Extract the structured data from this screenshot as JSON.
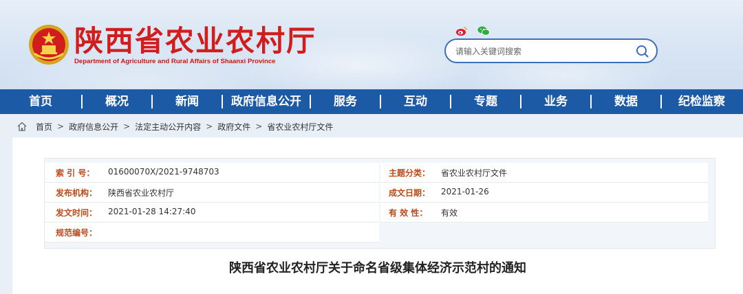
{
  "header": {
    "title": "陕西省农业农村厅",
    "subtitle": "Department of Agriculture and Rural Affairs of Shaanxi Province",
    "social": [
      "weibo-icon",
      "wechat-icon"
    ],
    "search": {
      "placeholder": "请输入关键词搜索"
    }
  },
  "nav": {
    "items": [
      {
        "label": "首页"
      },
      {
        "label": "概况"
      },
      {
        "label": "新闻"
      },
      {
        "label": "政府信息公开"
      },
      {
        "label": "服务"
      },
      {
        "label": "互动"
      },
      {
        "label": "专题"
      },
      {
        "label": "业务"
      },
      {
        "label": "数据"
      },
      {
        "label": "纪检监察"
      }
    ]
  },
  "breadcrumb": {
    "items": [
      "首页",
      "政府信息公开",
      "法定主动公开内容",
      "政府文件",
      "省农业农村厅文件"
    ],
    "separator": ">"
  },
  "meta": {
    "index_label": "索 引 号：",
    "index_value": "01600070X/2021-9748703",
    "category_label": "主题分类：",
    "category_value": "省农业农村厅文件",
    "org_label": "发布机构：",
    "org_value": "陕西省农业农村厅",
    "date_label": "成文日期：",
    "date_value": "2021-01-26",
    "time_label": "发文时间：",
    "time_value": "2021-01-28 14:27:40",
    "validity_label": "有 效 性：",
    "validity_value": "有效",
    "spec_label": "规范编号：",
    "spec_value": ""
  },
  "document": {
    "title": "陕西省农业农村厅关于命名省级集体经济示范村的通知"
  },
  "colors": {
    "brand_red": "#d21d1d",
    "nav_blue": "#1c5aa6",
    "label_orange": "#b94a1c"
  }
}
